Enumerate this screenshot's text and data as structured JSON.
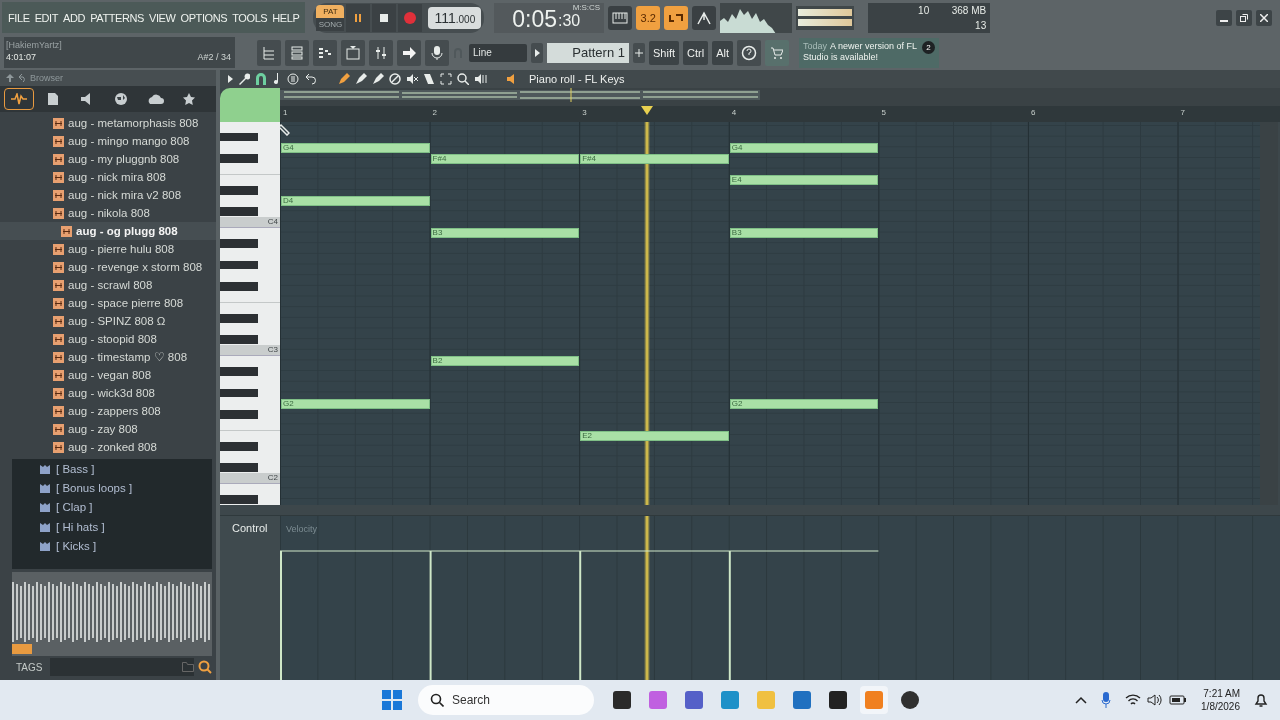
{
  "menu": [
    "FILE",
    "EDIT",
    "ADD",
    "PATTERNS",
    "VIEW",
    "OPTIONS",
    "TOOLS",
    "HELP"
  ],
  "transport": {
    "modes": [
      {
        "label": "PAT",
        "selected": true
      },
      {
        "label": "SONG",
        "selected": false
      }
    ],
    "tempo": "111",
    "tempo_fraction": ".000",
    "time": "0:05",
    "time_cs": ":30",
    "time_unit": "M:S:CS"
  },
  "toggles": [
    {
      "kind": "keyboard",
      "on": false
    },
    {
      "kind": "countdown",
      "label": "3.2",
      "on": true
    },
    {
      "kind": "loop",
      "on": true
    },
    {
      "kind": "metronome",
      "on": false
    }
  ],
  "monitor": {
    "cpu": "10",
    "memory": "368 MB",
    "polyphony": "13"
  },
  "hint_bar": {
    "user": "[HakiemYartz]",
    "time": "4:01:07",
    "note": "A#2 / 34"
  },
  "snap": {
    "value": "Line"
  },
  "pattern": {
    "name": "Pattern 1"
  },
  "modifiers": [
    "Shift",
    "Ctrl",
    "Alt"
  ],
  "news": {
    "when": "Today",
    "message": "A newer version of FL Studio is available!",
    "count": "2"
  },
  "browser": {
    "title": "Browser",
    "tabs": [
      {
        "kind": "all",
        "selected": true
      },
      {
        "kind": "files",
        "selected": false
      },
      {
        "kind": "plugins",
        "selected": false
      },
      {
        "kind": "online",
        "selected": false
      },
      {
        "kind": "cloud",
        "selected": false
      },
      {
        "kind": "favorites",
        "selected": false
      }
    ],
    "items": [
      {
        "label": "aug - metamorphasis 808",
        "selected": false
      },
      {
        "label": "aug - mingo mango 808",
        "selected": false
      },
      {
        "label": "aug - my pluggnb 808",
        "selected": false
      },
      {
        "label": "aug - nick mira 808",
        "selected": false
      },
      {
        "label": "aug - nick mira v2 808",
        "selected": false
      },
      {
        "label": "aug - nikola 808",
        "selected": false
      },
      {
        "label": "aug - og plugg 808",
        "selected": true
      },
      {
        "label": "aug - pierre hulu 808",
        "selected": false
      },
      {
        "label": "aug - revenge x storm 808",
        "selected": false
      },
      {
        "label": "aug - scrawl 808",
        "selected": false
      },
      {
        "label": "aug - space pierre 808",
        "selected": false
      },
      {
        "label": "aug - SPINZ 808 Ω",
        "selected": false
      },
      {
        "label": "aug - stoopid 808",
        "selected": false
      },
      {
        "label": "aug - timestamp ♡ 808",
        "selected": false
      },
      {
        "label": "aug - vegan 808",
        "selected": false
      },
      {
        "label": "aug - wick3d 808",
        "selected": false
      },
      {
        "label": "aug - zappers 808",
        "selected": false
      },
      {
        "label": "aug - zay 808",
        "selected": false
      },
      {
        "label": "aug - zonked 808",
        "selected": false
      }
    ],
    "folders": [
      "[ Bass ]",
      "[ Bonus loops ]",
      "[ Clap ]",
      "[ Hi hats ]",
      "[ Kicks ]"
    ],
    "tags_label": "TAGS"
  },
  "piano_roll": {
    "title": "Piano roll - FL Keys",
    "ruler": [
      "1",
      "2",
      "3",
      "4",
      "5",
      "6",
      "7"
    ],
    "octave_labels": [
      "C4",
      "C3",
      "C2"
    ],
    "bars": [
      {
        "notes": [
          "G4",
          "D4",
          "G2"
        ]
      },
      {
        "notes": [
          "F#4",
          "B3",
          "B2"
        ]
      },
      {
        "notes": [
          "F#4",
          "E2"
        ]
      },
      {
        "notes": [
          "G4",
          "E4",
          "B3",
          "G2"
        ]
      }
    ],
    "control": {
      "label": "Control",
      "target": "Velocity"
    }
  },
  "taskbar": {
    "search": {
      "placeholder": "Search"
    },
    "time": "7:21 AM",
    "date": "1/8/2026"
  }
}
